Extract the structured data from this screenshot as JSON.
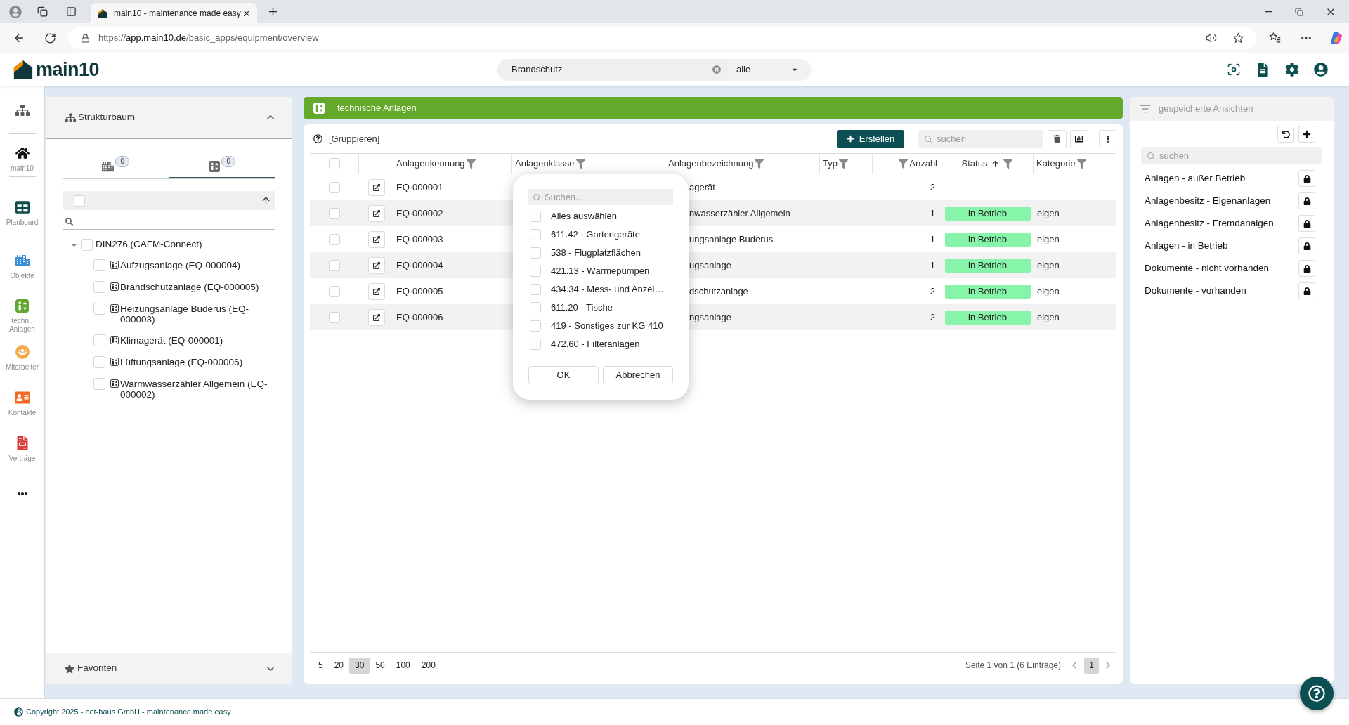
{
  "browser": {
    "tab_title": "main10 - maintenance made easy",
    "url_scheme": "https://",
    "url_host": "app.main10.de",
    "url_path": "/basic_apps/equipment/overview"
  },
  "app_header": {
    "logo": "main10",
    "search": {
      "value": "Brandschutz"
    },
    "scope": {
      "value": "alle"
    }
  },
  "nav_rail": [
    {
      "kind": "structure",
      "color": "#5c5c5c"
    },
    {
      "kind": "divider"
    },
    {
      "kind": "home",
      "label": "main10",
      "color": "#111111"
    },
    {
      "kind": "divider"
    },
    {
      "kind": "planboard",
      "label": "Planboard",
      "color": "#0f4c4c"
    },
    {
      "kind": "divider"
    },
    {
      "kind": "objects",
      "label": "Objekte",
      "color": "#3a8fd8"
    },
    {
      "kind": "equipment",
      "label": "techn.. Anlagen",
      "color": "#62a730"
    },
    {
      "kind": "staff",
      "label": "Mitarbeiter",
      "color": "#f6a94a"
    },
    {
      "kind": "contacts",
      "label": "Kontakte",
      "color": "#f26a26"
    },
    {
      "kind": "contracts",
      "label": "Verträge",
      "color": "#d93a3a"
    },
    {
      "kind": "more",
      "color": "#1a1a1a"
    }
  ],
  "structure_panel": {
    "title": "Strukturbaum",
    "expanded": true,
    "tabs": [
      {
        "kind": "objects",
        "badge": "0",
        "selected": false
      },
      {
        "kind": "equipment",
        "badge": "0",
        "selected": true
      }
    ],
    "select_all": {
      "checked": false
    },
    "tree": [
      {
        "label": "DIN276 (CAFM-Connect)",
        "checked": false,
        "expanded": true,
        "children": [
          {
            "label": "Aufzugsanlage (EQ-000004)",
            "checked": false
          },
          {
            "label": "Brandschutzanlage (EQ-000005)",
            "checked": false
          },
          {
            "label": "Heizungsanlage Buderus (EQ-000003)",
            "checked": false
          },
          {
            "label": "Klimagerät (EQ-000001)",
            "checked": false
          },
          {
            "label": "Lüftungsanlage (EQ-000006)",
            "checked": false
          },
          {
            "label": "Warmwasserzähler Allgemein (EQ-000002)",
            "checked": false
          }
        ]
      }
    ],
    "favorites": {
      "title": "Favoriten",
      "expanded": false
    }
  },
  "main": {
    "title": "technische Anlagen",
    "toolbar": {
      "group_link": "[Gruppieren]",
      "create_button": "Erstellen",
      "search": {
        "placeholder": "suchen"
      }
    },
    "table": {
      "select_all": {
        "checked": false
      },
      "columns": [
        {
          "label": "Anlagenkennung",
          "kind": "text",
          "filter": true,
          "sorted": false
        },
        {
          "label": "Anlagenklasse",
          "kind": "text",
          "filter": true,
          "sorted": false
        },
        {
          "label": "Anlagenbezeichnung",
          "kind": "text",
          "filter": true,
          "sorted": false
        },
        {
          "label": "Typ",
          "kind": "text",
          "filter": true,
          "sorted": false
        },
        {
          "label": "Anzahl",
          "kind": "number",
          "filter": true,
          "sorted": false
        },
        {
          "label": "Status",
          "kind": "status",
          "filter": true,
          "sorted": true
        },
        {
          "label": "Kategorie",
          "kind": "text",
          "filter": true,
          "sorted": false
        }
      ],
      "rows": [
        {
          "checked": false,
          "anlagenkennung": "EQ-000001",
          "anlagenbezeichnung": "agerät",
          "anzahl": "2"
        },
        {
          "checked": false,
          "anlagenkennung": "EQ-000002",
          "anlagenbezeichnung": "nwasserzähler Allgemein",
          "anzahl": "1",
          "status": "in Betrieb",
          "kategorie": "eigen"
        },
        {
          "checked": false,
          "anlagenkennung": "EQ-000003",
          "anlagenbezeichnung": "ungsanlage Buderus",
          "anzahl": "1",
          "status": "in Betrieb",
          "kategorie": "eigen"
        },
        {
          "checked": false,
          "anlagenkennung": "EQ-000004",
          "anlagenbezeichnung": "ugsanlage",
          "anzahl": "1",
          "status": "in Betrieb",
          "kategorie": "eigen"
        },
        {
          "checked": false,
          "anlagenkennung": "EQ-000005",
          "anlagenbezeichnung": "dschutzanlage",
          "anzahl": "2",
          "status": "in Betrieb",
          "kategorie": "eigen"
        },
        {
          "checked": false,
          "anlagenkennung": "EQ-000006",
          "anlagenbezeichnung": "ngsanlage",
          "anzahl": "2",
          "status": "in Betrieb",
          "kategorie": "eigen"
        }
      ]
    },
    "filter_popup": {
      "search": {
        "placeholder": "Suchen..."
      },
      "options": [
        {
          "label": "Alles auswählen",
          "checked": false
        },
        {
          "label": "611.42 - Gartengeräte",
          "checked": false
        },
        {
          "label": "538 - Flugplatzflächen",
          "checked": false
        },
        {
          "label": "421.13 - Wärmepumpen",
          "checked": false
        },
        {
          "label": "434.34 - Mess- und Anzei…",
          "checked": false
        },
        {
          "label": "611.20 - Tische",
          "checked": false
        },
        {
          "label": "419 - Sonstiges zur KG 410",
          "checked": false
        },
        {
          "label": "472.60 - Filteranlagen",
          "checked": false
        }
      ],
      "buttons": [
        "OK",
        "Abbrechen"
      ]
    },
    "pagination": {
      "page_sizes": [
        {
          "label": "5",
          "selected": false
        },
        {
          "label": "20",
          "selected": false
        },
        {
          "label": "30",
          "selected": true
        },
        {
          "label": "50",
          "selected": false
        },
        {
          "label": "100",
          "selected": false
        },
        {
          "label": "200",
          "selected": false
        }
      ],
      "summary": "Seite 1 von 1 (6 Einträge)",
      "pages": [
        {
          "label": "1",
          "selected": true
        }
      ]
    }
  },
  "saved_views": {
    "title": "gespeicherte Ansichten",
    "search": {
      "placeholder": "suchen"
    },
    "views": [
      {
        "label": "Anlagen - außer Betrieb"
      },
      {
        "label": "Anlagenbesitz - Eigenanlagen"
      },
      {
        "label": "Anlagenbesitz - Fremdanalgen"
      },
      {
        "label": "Anlagen - in Betrieb"
      },
      {
        "label": "Dokumente - nicht vorhanden"
      },
      {
        "label": "Dokumente - vorhanden"
      }
    ]
  },
  "footer": {
    "copyright": "Copyright 2025 - net-haus GmbH - maintenance made easy"
  }
}
